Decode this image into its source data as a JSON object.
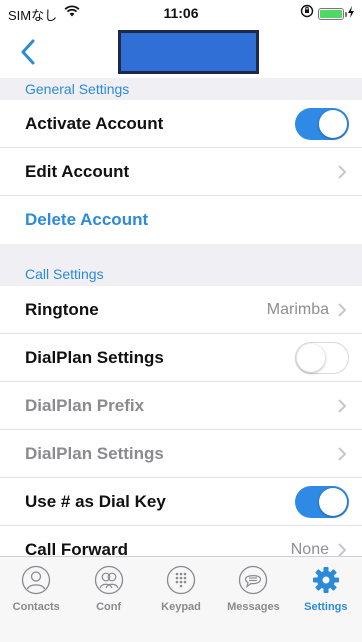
{
  "status_bar": {
    "carrier": "SIMなし",
    "time": "11:06"
  },
  "nav": {
    "back_icon": "chevron-left-icon",
    "title": ""
  },
  "colors": {
    "accent": "#2c8bd9",
    "toggle_on": "#2f8ae6",
    "section_bg": "#efeff4"
  },
  "sections": {
    "general": {
      "header": "General Settings",
      "activate_account": {
        "label": "Activate Account",
        "on": true
      },
      "edit_account": {
        "label": "Edit Account"
      },
      "delete_account": {
        "label": "Delete Account"
      }
    },
    "call": {
      "header": "Call Settings",
      "ringtone": {
        "label": "Ringtone",
        "value": "Marimba"
      },
      "dialplan_settings": {
        "label": "DialPlan Settings",
        "on": false
      },
      "dialplan_prefix": {
        "label": "DialPlan Prefix"
      },
      "dialplan_settings_2": {
        "label": "DialPlan Settings"
      },
      "use_hash_dial_key": {
        "label": "Use # as Dial Key",
        "on": true
      },
      "call_forward": {
        "label": "Call Forward",
        "value": "None"
      }
    }
  },
  "tabs": [
    {
      "label": "Contacts",
      "icon": "person-icon",
      "active": false
    },
    {
      "label": "Conf",
      "icon": "group-icon",
      "active": false
    },
    {
      "label": "Keypad",
      "icon": "keypad-icon",
      "active": false
    },
    {
      "label": "Messages",
      "icon": "message-icon",
      "active": false
    },
    {
      "label": "Settings",
      "icon": "gear-icon",
      "active": true
    }
  ]
}
